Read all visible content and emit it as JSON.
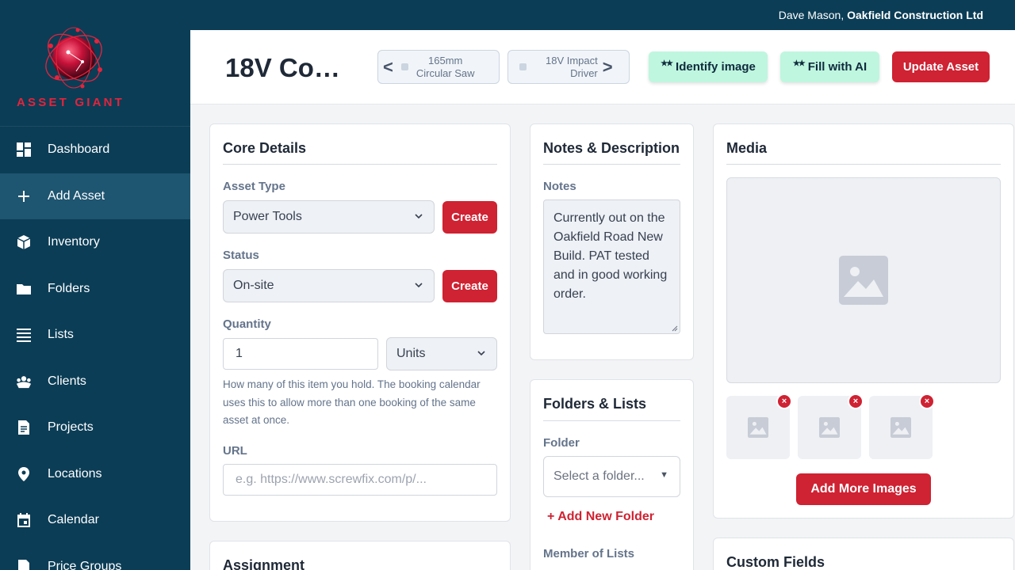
{
  "topbar": {
    "user_name": "Dave Mason,",
    "company": "Oakfield Construction Ltd"
  },
  "sidebar": {
    "logo_text": "ASSET GIANT",
    "items": [
      {
        "label": "Dashboard",
        "icon": "dashboard-icon",
        "active": false
      },
      {
        "label": "Add Asset",
        "icon": "plus-icon",
        "active": true
      },
      {
        "label": "Inventory",
        "icon": "box-icon",
        "active": false
      },
      {
        "label": "Folders",
        "icon": "folder-icon",
        "active": false
      },
      {
        "label": "Lists",
        "icon": "list-icon",
        "active": false
      },
      {
        "label": "Clients",
        "icon": "clients-icon",
        "active": false
      },
      {
        "label": "Projects",
        "icon": "document-icon",
        "active": false
      },
      {
        "label": "Locations",
        "icon": "location-pin-icon",
        "active": false
      },
      {
        "label": "Calendar",
        "icon": "calendar-icon",
        "active": false
      },
      {
        "label": "Price Groups",
        "icon": "document-icon",
        "active": false
      }
    ]
  },
  "header": {
    "title": "18V Co…",
    "prev": {
      "arrow": "<",
      "label_line1": "165mm",
      "label_line2": "Circular Saw"
    },
    "next": {
      "arrow": ">",
      "label_line1": "18V Impact",
      "label_line2": "Driver"
    },
    "identify_label": "Identify image",
    "fill_label": "Fill with AI",
    "update_label": "Update Asset"
  },
  "core": {
    "title": "Core Details",
    "asset_type_label": "Asset Type",
    "asset_type_value": "Power Tools",
    "status_label": "Status",
    "status_value": "On-site",
    "create_label": "Create",
    "quantity_label": "Quantity",
    "quantity_value": "1",
    "unit_value": "Units",
    "quantity_help": "How many of this item you hold. The booking calendar uses this to allow more than one booking of the same asset at once.",
    "url_label": "URL",
    "url_placeholder": "e.g. https://www.screwfix.com/p/..."
  },
  "assignment": {
    "title": "Assignment"
  },
  "notes": {
    "title": "Notes & Description",
    "notes_label": "Notes",
    "notes_value": "Currently out on the Oakfield Road New Build. PAT tested and in good working order."
  },
  "folders": {
    "title": "Folders & Lists",
    "folder_label": "Folder",
    "folder_placeholder": "Select a folder...",
    "add_folder_label": "+ Add New Folder",
    "member_label": "Member of Lists"
  },
  "media": {
    "title": "Media",
    "remove_symbol": "×",
    "add_more_label": "Add More Images"
  },
  "custom_fields": {
    "title": "Custom Fields"
  },
  "colors": {
    "sidebar_bg": "#0b3d56",
    "active_bg": "#1e5571",
    "primary_red": "#cf2232",
    "ai_green": "#bff6df"
  }
}
